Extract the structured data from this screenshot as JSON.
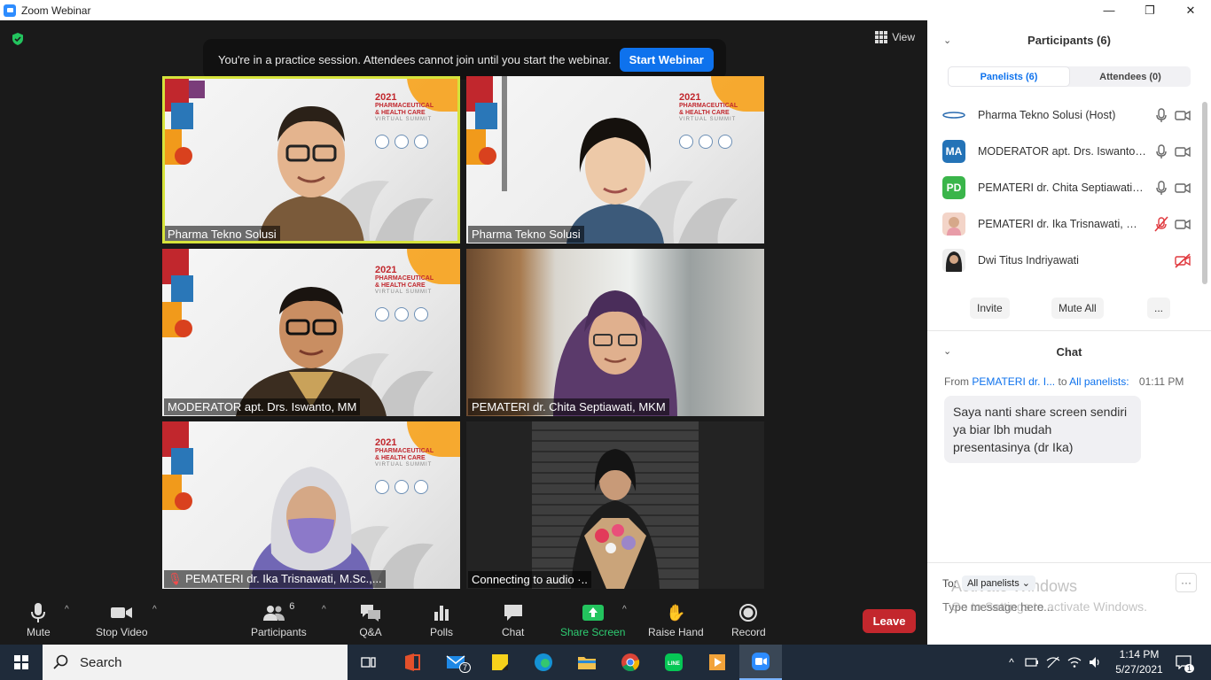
{
  "window": {
    "title": "Zoom Webinar",
    "controls": {
      "minimize": "—",
      "maximize": "❐",
      "close": "✕"
    }
  },
  "meeting": {
    "view_label": "View",
    "banner": {
      "message": "You're in a practice session. Attendees cannot join until you start the webinar.",
      "button": "Start Webinar"
    },
    "summit": {
      "year": "2021",
      "line1": "PHARMACEUTICAL",
      "line2": "& HEALTH CARE",
      "line3": "VIRTUAL SUMMIT"
    },
    "tiles": [
      {
        "name": "Pharma Tekno Solusi",
        "active": true
      },
      {
        "name": "Pharma Tekno Solusi",
        "active": false
      },
      {
        "name": "MODERATOR apt. Drs. Iswanto, MM",
        "active": false
      },
      {
        "name": "PEMATERI dr. Chita Septiawati, MKM",
        "active": false
      },
      {
        "name": "PEMATERI dr. Ika Trisnawati, M.Sc.,...",
        "active": false,
        "muted": true
      },
      {
        "name": "Connecting to audio ·..",
        "active": false
      }
    ]
  },
  "toolbar": {
    "mute": "Mute",
    "stop_video": "Stop Video",
    "participants": "Participants",
    "participants_count": "6",
    "qa": "Q&A",
    "polls": "Polls",
    "chat": "Chat",
    "share_screen": "Share Screen",
    "raise_hand": "Raise Hand",
    "record": "Record",
    "leave": "Leave"
  },
  "panel": {
    "participants_title": "Participants (6)",
    "tabs": [
      {
        "label": "Panelists (6)",
        "active": true
      },
      {
        "label": "Attendees (0)",
        "active": false
      }
    ],
    "participants": [
      {
        "name": "Pharma Tekno Solusi (Host)",
        "avatar": "logo",
        "mic": "on",
        "video": "off"
      },
      {
        "name": "MODERATOR apt. Drs. Iswanto, ...",
        "avatar": "MA",
        "avatar_color": "#2473b7",
        "mic": "on",
        "video": "off"
      },
      {
        "name": "PEMATERI dr. Chita Septiawati, ...",
        "avatar": "PD",
        "avatar_color": "#3ab54a",
        "mic": "on",
        "video": "off"
      },
      {
        "name": "PEMATERI dr. Ika Trisnawati, M....",
        "avatar": "photo",
        "mic": "muted",
        "video": "off"
      },
      {
        "name": "Dwi Titus Indriyawati",
        "avatar": "photo",
        "mic": "none",
        "video": "stopped"
      }
    ],
    "buttons": {
      "invite": "Invite",
      "mute_all": "Mute All",
      "more": "..."
    },
    "chat_title": "Chat",
    "chat": {
      "from_label": "From",
      "sender": "PEMATERI dr. I...",
      "to_label": "to",
      "recipient": "All panelists:",
      "time": "01:11 PM",
      "message": "Saya nanti share screen sendiri ya biar lbh mudah presentasinya (dr Ika)"
    },
    "compose": {
      "to_label": "To:",
      "to_value": "All panelists",
      "more": "···",
      "placeholder": "Type message here..."
    },
    "watermark": {
      "line1": "Activate Windows",
      "line2": "Go to Settings to activate Windows."
    }
  },
  "taskbar": {
    "search_label": "Search",
    "mail_badge": "7",
    "time": "1:14 PM",
    "date": "5/27/2021",
    "notification_count": "1"
  }
}
